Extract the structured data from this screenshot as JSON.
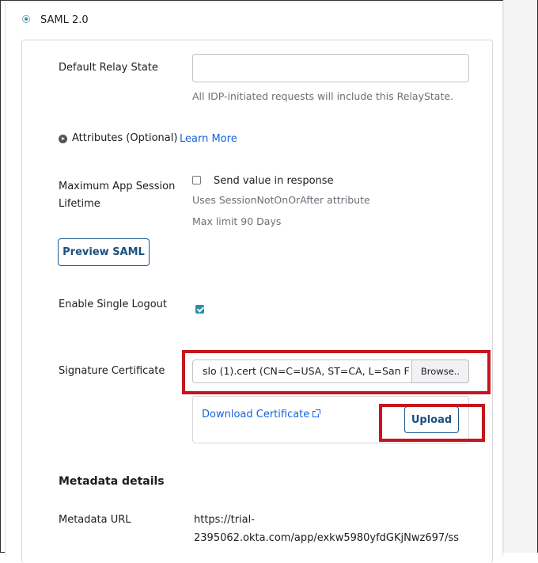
{
  "saml_option": {
    "label": "SAML 2.0"
  },
  "relay_state": {
    "label": "Default Relay State",
    "value": "",
    "hint": "All IDP-initiated requests will include this RelayState."
  },
  "attributes": {
    "label": "Attributes (Optional)",
    "learn_more": "Learn More"
  },
  "session_lifetime": {
    "label_line1": "Maximum App Session",
    "label_line2": "Lifetime",
    "checkbox_label": "Send value in response",
    "hint1": "Uses SessionNotOnOrAfter attribute",
    "hint2": "Max limit 90 Days"
  },
  "preview_button": "Preview SAML",
  "single_logout": {
    "label": "Enable Single Logout"
  },
  "signature_certificate": {
    "label": "Signature Certificate",
    "file_value": "slo (1).cert (CN=C=USA, ST=CA, L=San F",
    "browse_label": "Browse..",
    "download_label": "Download Certificate",
    "upload_label": "Upload"
  },
  "metadata": {
    "section_title": "Metadata details",
    "url_label": "Metadata URL",
    "url_line1": "https://trial-",
    "url_line2": "2395062.okta.com/app/exkw5980yfdGKjNwz697/ss"
  },
  "colors": {
    "accent": "#2b8ea8",
    "link": "#1662dd",
    "highlight": "#c4161c"
  }
}
